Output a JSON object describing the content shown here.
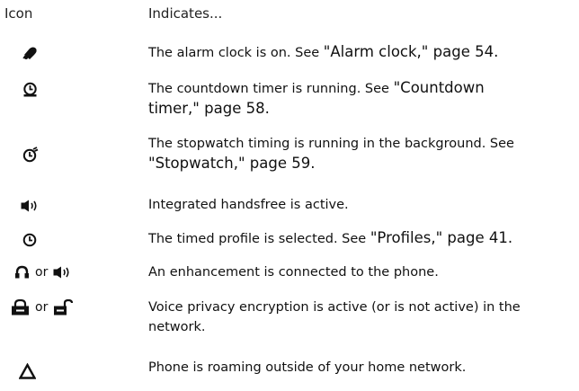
{
  "header": {
    "icon_col": "Icon",
    "indicates_col": "Indicates..."
  },
  "rows": [
    {
      "icon": "alarm-clock-icon",
      "text": "The alarm clock is on. See ",
      "ref": "\"Alarm clock,\" page 54."
    },
    {
      "icon": "countdown-timer-icon",
      "text": "The countdown timer is running. See ",
      "ref1": "\"Countdown",
      "ref2": "timer,\" page 58."
    },
    {
      "icon": "stopwatch-icon",
      "text": "The stopwatch timing is running in the background. See",
      "ref": "\"Stopwatch,\" page 59."
    },
    {
      "icon": "handsfree-speaker-icon",
      "text": "Integrated handsfree is active."
    },
    {
      "icon": "timed-profile-icon",
      "text": "The timed profile is selected. See ",
      "ref": "\"Profiles,\" page 41."
    },
    {
      "icon_a": "enhancement-icon",
      "or": "or",
      "icon_b": "handsfree-speaker-icon",
      "text": "An enhancement is connected to the phone."
    },
    {
      "icon_a": "locked-padlock-icon",
      "or": "or",
      "icon_b": "unlocked-padlock-icon",
      "text1": "Voice privacy encryption is active (or is not active) in the",
      "text2": "network."
    },
    {
      "icon": "roaming-triangle-icon",
      "text": "Phone is roaming outside of your home network."
    }
  ]
}
